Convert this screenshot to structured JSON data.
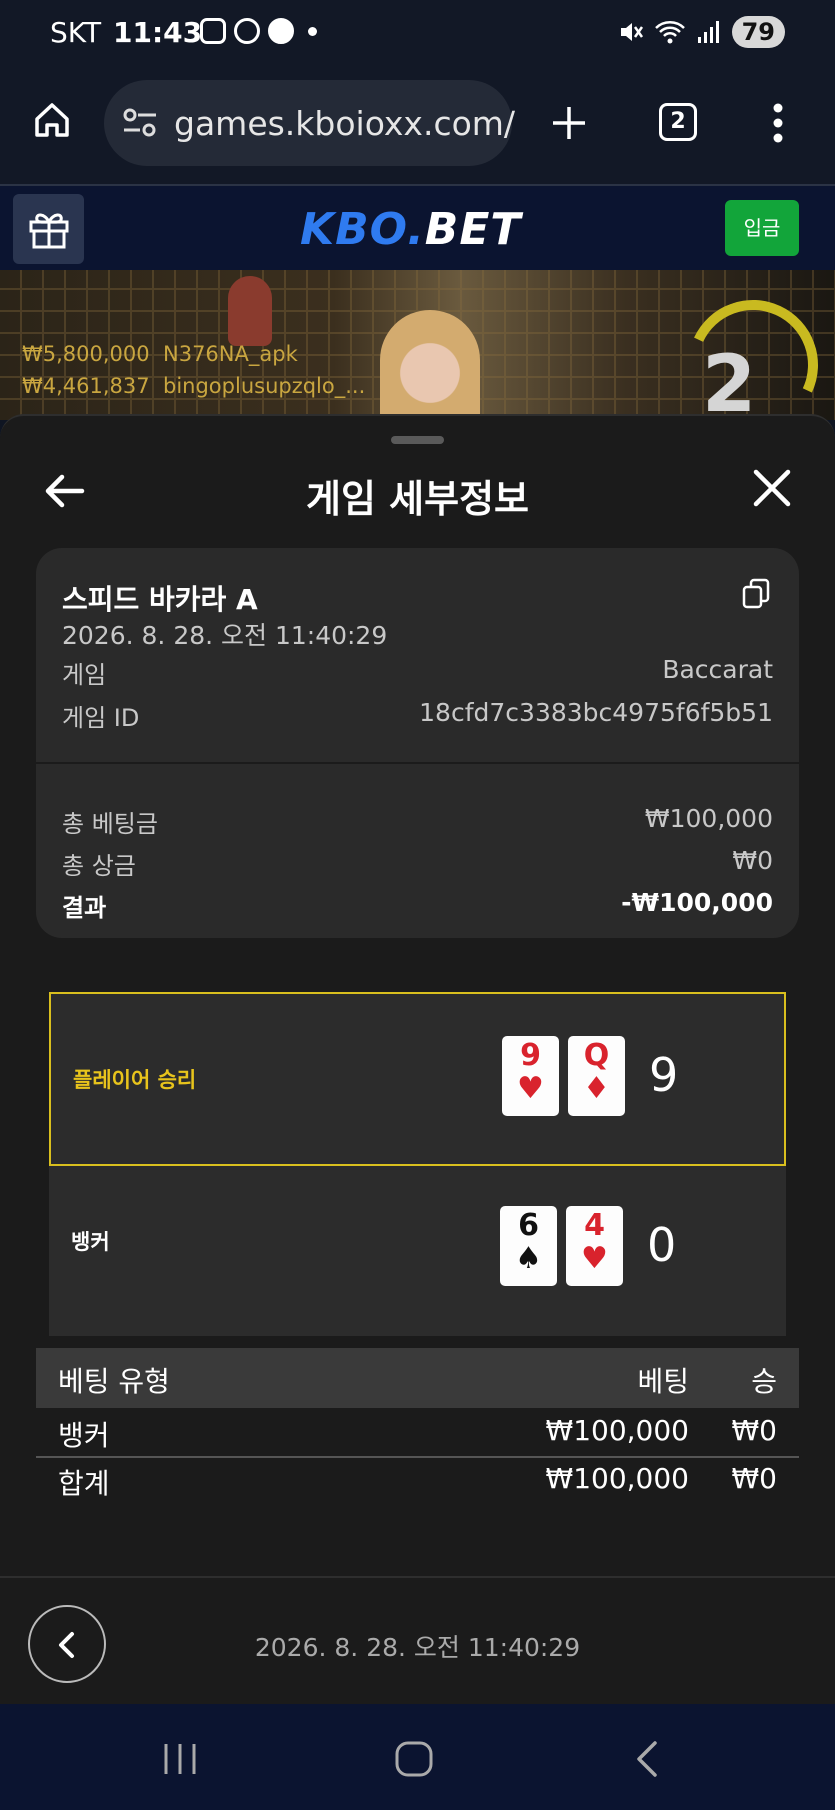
{
  "status_bar": {
    "carrier": "SKT",
    "time": "11:43",
    "battery": "79",
    "icons": [
      "camera-icon",
      "kakaotalk-icon",
      "message-icon",
      "mute-icon",
      "wifi-icon",
      "signal-icon",
      "battery-icon"
    ]
  },
  "browser": {
    "url": "games.kboioxx.com/",
    "tab_count": "2"
  },
  "site_header": {
    "brand_part1": "KBO.",
    "brand_part2": "BET",
    "deposit_label": "입금"
  },
  "banner": {
    "wins": [
      {
        "amount": "₩5,800,000",
        "user": "N376NA_apk"
      },
      {
        "amount": "₩4,461,837",
        "user": "bingoplusupzqlo_..."
      }
    ],
    "timer": "2"
  },
  "details": {
    "title": "게임 세부정보",
    "game_name": "스피드 바카라 A",
    "game_date": "2026. 8. 28. 오전 11:40:29",
    "game_label": "게임",
    "game_value": "Baccarat",
    "game_id_label": "게임 ID",
    "game_id_value": "18cfd7c3383bc4975f6f5b51",
    "total_bet_label": "총 베팅금",
    "total_bet_value": "₩100,000",
    "total_win_label": "총 상금",
    "total_win_value": "₩0",
    "result_label": "결과",
    "result_value": "-₩100,000"
  },
  "hands": {
    "player": {
      "label": "플레이어 승리",
      "cards": [
        {
          "rank": "9",
          "suit": "♥"
        },
        {
          "rank": "Q",
          "suit": "♦"
        }
      ],
      "score": "9"
    },
    "banker": {
      "label": "뱅커",
      "cards": [
        {
          "rank": "6",
          "suit": "♠"
        },
        {
          "rank": "4",
          "suit": "♥"
        }
      ],
      "score": "0"
    }
  },
  "bets": {
    "headers": {
      "type": "베팅 유형",
      "bet": "베팅",
      "win": "승"
    },
    "rows": [
      {
        "type": "뱅커",
        "bet": "₩100,000",
        "win": "₩0"
      },
      {
        "type": "합계",
        "bet": "₩100,000",
        "win": "₩0"
      }
    ]
  },
  "footer": {
    "date": "2026. 8. 28. 오전 11:40:29"
  },
  "colors": {
    "brand_blue": "#2f7bf0",
    "deposit_green": "#12a53a",
    "player_highlight": "#d9bf1e",
    "card_red": "#d9232d"
  }
}
